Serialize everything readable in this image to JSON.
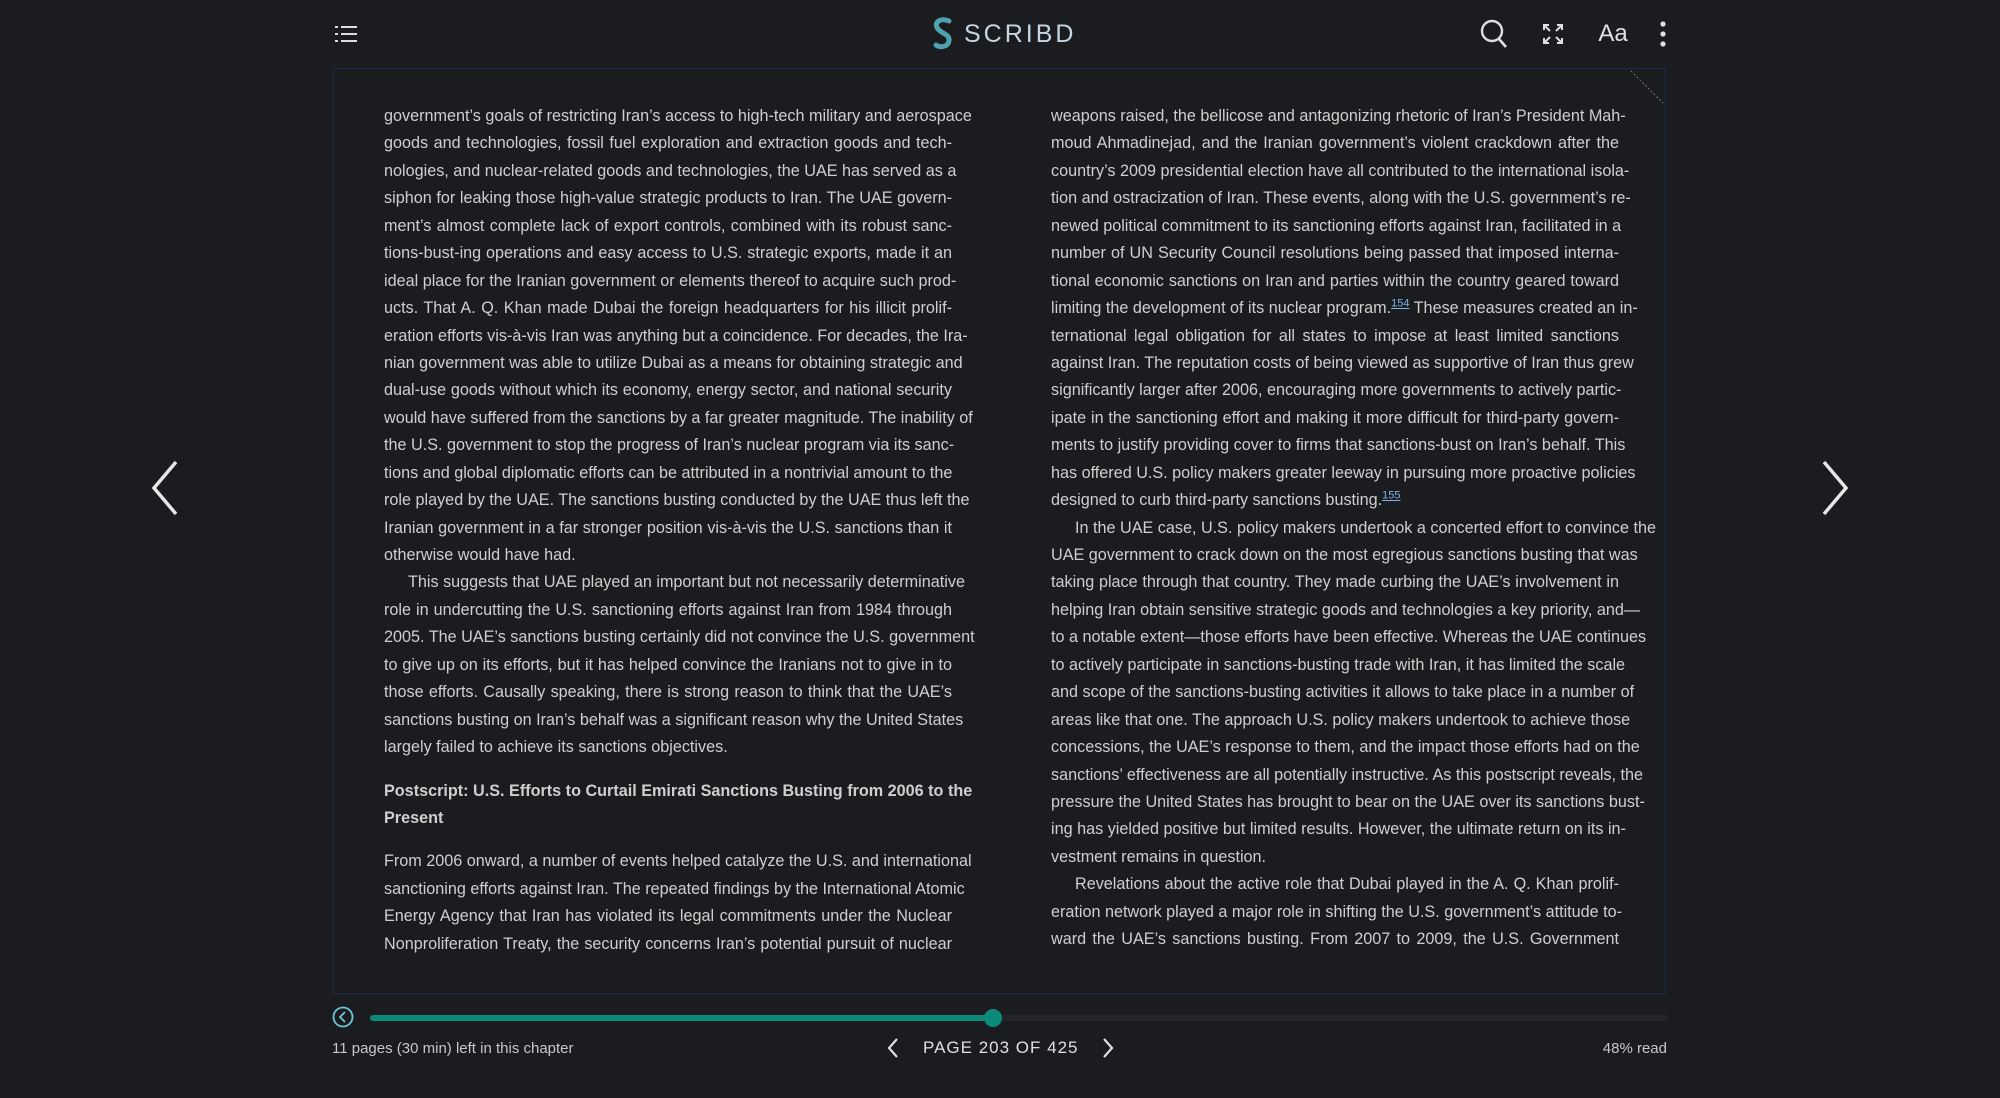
{
  "header": {
    "brand": "SCRIBD",
    "brand_color": "#4fa3b0",
    "icons": [
      "list-icon",
      "search-icon",
      "fullscreen-icon",
      "font-settings-icon",
      "more-icon"
    ],
    "font_label": "Aa"
  },
  "reader": {
    "left_column": [
      {
        "type": "p",
        "lines": [
          "government’s goals of restricting Iran’s access to high-tech military and aerospace",
          "goods and technologies, fossil fuel exploration and extraction goods and tech-",
          "nologies, and nuclear-related goods and technologies, the UAE has served as a",
          "siphon for leaking those high-value strategic products to Iran. The UAE govern-",
          "ment’s almost complete lack of export controls, combined with its robust sanc-",
          "tions-bust-ing operations and easy access to U.S. strategic exports, made it an",
          "ideal place for the Iranian government or elements thereof to acquire such prod-",
          "ucts. That A. Q. Khan made Dubai the foreign headquarters for his illicit prolif-",
          "eration efforts vis-à-vis Iran was anything but a coincidence. For decades, the Ira-",
          "nian government was able to utilize Dubai as a means for obtaining strategic and",
          "dual-use goods without which its economy, energy sector, and national security",
          "would have suffered from the sanctions by a far greater magnitude. The inability of",
          "the U.S. government to stop the progress of Iran’s nuclear program via its sanc-",
          "tions and global diplomatic efforts can be attributed in a nontrivial amount to the",
          "role played by the UAE. The sanctions busting conducted by the UAE thus left the",
          "Iranian government in a far stronger position vis-à-vis the U.S. sanctions than it",
          "otherwise would have had."
        ]
      },
      {
        "type": "p",
        "indent": true,
        "lines": [
          "This suggests that UAE played an important but not necessarily determinative",
          "role in undercutting the U.S. sanctioning efforts against Iran from 1984 through",
          "2005. The UAE’s sanctions busting certainly did not convince the U.S. government",
          "to give up on its efforts, but it has helped convince the Iranians not to give in to",
          "those efforts. Causally speaking, there is strong reason to think that the UAE’s",
          "sanctions busting on Iran’s behalf was a significant reason why the United States",
          "largely failed to achieve its sanctions objectives."
        ]
      },
      {
        "type": "h",
        "gap": true,
        "lines": [
          "Postscript: U.S. Efforts to Curtail Emirati Sanctions Busting from 2006 to the",
          "Present"
        ]
      },
      {
        "type": "p",
        "gap": true,
        "continues": true,
        "lines": [
          "From 2006 onward, a number of events helped catalyze the U.S. and international",
          "sanctioning efforts against Iran. The repeated findings by the International Atomic",
          "Energy Agency that Iran has violated its legal commitments under the Nuclear",
          "Nonproliferation Treaty, the security concerns Iran’s potential pursuit of nuclear"
        ]
      }
    ],
    "right_column": [
      {
        "type": "p",
        "lines": [
          "weapons raised, the bellicose and antagonizing rhetoric of Iran’s President Mah-",
          "moud Ahmadinejad, and the Iranian government’s violent crackdown after the",
          "country’s 2009 presidential election have all contributed to the international isola-",
          "tion and ostracization of Iran. These events, along with the U.S. government’s re-",
          "newed political commitment to its sanctioning efforts against Iran, facilitated in a",
          "number of UN Security Council resolutions being passed that imposed interna-",
          "tional economic sanctions on Iran and parties within the country geared toward",
          {
            "before": "limiting the development of its nuclear program.",
            "ref": "154",
            "after": " These measures created an in-"
          },
          "ternational legal obligation for all states to impose at least limited sanctions",
          "against Iran. The reputation costs of being viewed as supportive of Iran thus grew",
          "significantly larger after 2006, encouraging more governments to actively partic-",
          "ipate in the sanctioning effort and making it more difficult for third-party govern-",
          "ments to justify providing cover to firms that sanctions-bust on Iran’s behalf. This",
          "has offered U.S. policy makers greater leeway in pursuing more proactive policies",
          {
            "before": "designed to curb third-party sanctions busting.",
            "ref": "155",
            "after": ""
          }
        ]
      },
      {
        "type": "p",
        "indent": true,
        "lines": [
          "In the UAE case, U.S. policy makers undertook a concerted effort to convince the",
          "UAE government to crack down on the most egregious sanctions busting that was",
          "taking place through that country. They made curbing the UAE’s involvement in",
          "helping Iran obtain sensitive strategic goods and technologies a key priority, and—",
          "to a notable extent—those efforts have been effective. Whereas the UAE continues",
          "to actively participate in sanctions-busting trade with Iran, it has limited the scale",
          "and scope of the sanctions-busting activities it allows to take place in a number of",
          "areas like that one. The approach U.S. policy makers undertook to achieve those",
          "concessions, the UAE’s response to them, and the impact those efforts had on the",
          "sanctions’ effectiveness are all potentially instructive. As this postscript reveals, the",
          "pressure the United States has brought to bear on the UAE over its sanctions bust-",
          "ing has yielded positive but limited results. However, the ultimate return on its in-",
          "vestment remains in question."
        ]
      },
      {
        "type": "p",
        "indent": true,
        "continues": true,
        "lines": [
          "Revelations about the active role that Dubai played in the A. Q. Khan prolif-",
          "eration network played a major role in shifting the U.S. government’s attitude to-",
          "ward the UAE’s sanctions busting. From 2007 to 2009, the U.S. Government"
        ]
      }
    ]
  },
  "footer": {
    "progress_percent": 48,
    "progress_color": "#0b8a78",
    "chapter_left": "11 pages (30 min) left in this chapter",
    "page_label": "PAGE 203 OF 425",
    "percent_read": "48% read"
  }
}
